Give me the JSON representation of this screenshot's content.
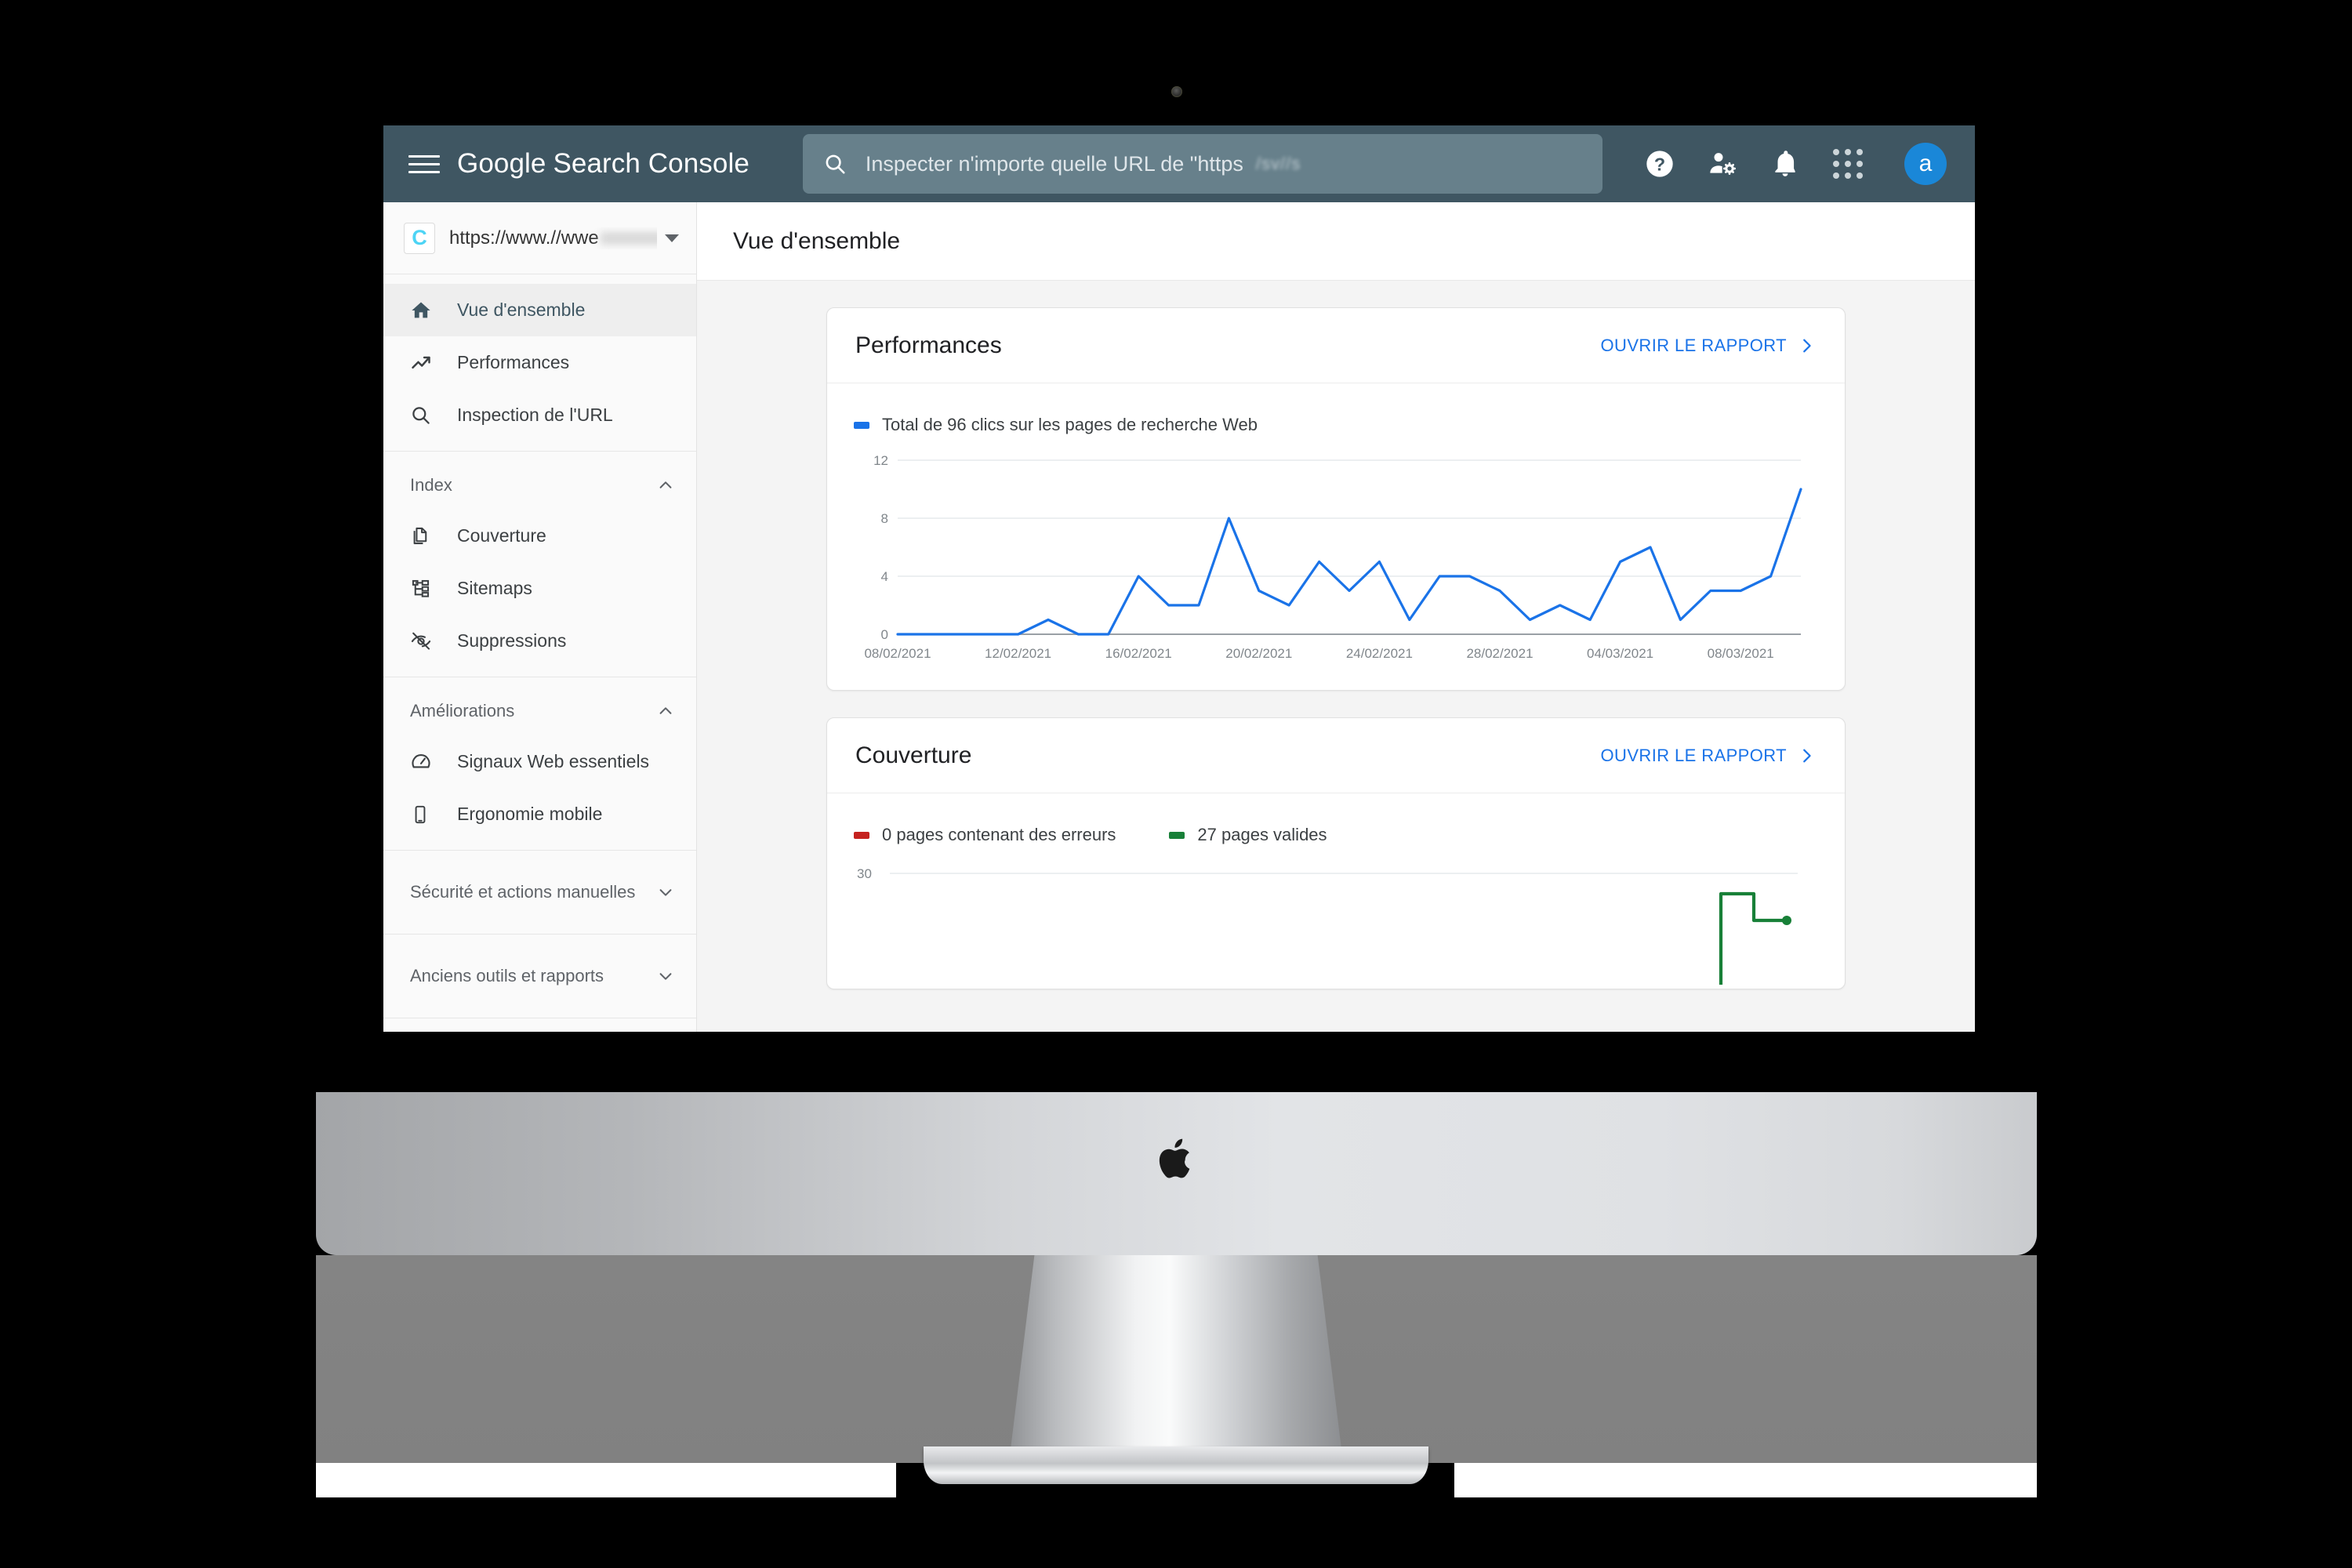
{
  "header": {
    "menu_icon": "hamburger-menu-icon",
    "brand_google": "Google",
    "brand_product": "Search Console",
    "search_icon": "search-icon",
    "search_placeholder": "Inspecter n'importe quelle URL de \"https",
    "search_value": "",
    "search_redacted": "/sv//s",
    "help_icon": "help-icon",
    "users_icon": "user-settings-icon",
    "bell_icon": "notifications-bell-icon",
    "apps_icon": "apps-grid-icon",
    "avatar_letter": "a",
    "bg_color": "#3f5662",
    "search_bg_color": "#67808b",
    "avatar_color": "#1a87d8"
  },
  "sidebar": {
    "property": {
      "favicon_letter": "C",
      "url": "https://www.//wwe"
    },
    "primary": [
      {
        "label": "Vue d'ensemble",
        "icon": "home-icon",
        "active": true
      },
      {
        "label": "Performances",
        "icon": "trending-up-icon",
        "active": false
      },
      {
        "label": "Inspection de l'URL",
        "icon": "search-icon",
        "active": false
      }
    ],
    "sections": [
      {
        "title": "Index",
        "expanded": true,
        "items": [
          {
            "label": "Couverture",
            "icon": "copy-pages-icon"
          },
          {
            "label": "Sitemaps",
            "icon": "sitemap-tree-icon"
          },
          {
            "label": "Suppressions",
            "icon": "eye-off-icon"
          }
        ]
      },
      {
        "title": "Améliorations",
        "expanded": true,
        "items": [
          {
            "label": "Signaux Web essentiels",
            "icon": "speedometer-icon"
          },
          {
            "label": "Ergonomie mobile",
            "icon": "mobile-phone-icon"
          }
        ]
      },
      {
        "title": "Sécurité et actions manuelles",
        "expanded": false,
        "items": []
      },
      {
        "title": "Anciens outils et rapports",
        "expanded": false,
        "items": []
      }
    ]
  },
  "main": {
    "page_title": "Vue d'ensemble",
    "cards": [
      {
        "title": "Performances",
        "action_label": "OUVRIR LE RAPPORT",
        "action_icon": "chevron-right-icon"
      },
      {
        "title": "Couverture",
        "action_label": "OUVRIR LE RAPPORT",
        "action_icon": "chevron-right-icon"
      }
    ]
  },
  "chart_data": [
    {
      "type": "line",
      "title": "Performances",
      "legend": [
        {
          "label": "Total de 96 clics sur les pages de recherche Web",
          "color": "#1a73e8"
        }
      ],
      "legend_position": "top-left",
      "grid": true,
      "xlabel": "",
      "ylabel": "",
      "ylim": [
        0,
        12
      ],
      "yticks": [
        0,
        4,
        8,
        12
      ],
      "xticks": [
        "08/02/2021",
        "12/02/2021",
        "16/02/2021",
        "20/02/2021",
        "24/02/2021",
        "28/02/2021",
        "04/03/2021",
        "08/03/2021"
      ],
      "x": [
        "08/02/2021",
        "09/02/2021",
        "10/02/2021",
        "11/02/2021",
        "12/02/2021",
        "13/02/2021",
        "14/02/2021",
        "15/02/2021",
        "16/02/2021",
        "17/02/2021",
        "18/02/2021",
        "19/02/2021",
        "20/02/2021",
        "21/02/2021",
        "22/02/2021",
        "23/02/2021",
        "24/02/2021",
        "25/02/2021",
        "26/02/2021",
        "27/02/2021",
        "28/02/2021",
        "01/03/2021",
        "02/03/2021",
        "03/03/2021",
        "04/03/2021",
        "05/03/2021",
        "06/03/2021",
        "07/03/2021",
        "08/03/2021",
        "09/03/2021"
      ],
      "values": [
        0,
        0,
        0,
        0,
        0,
        1,
        0,
        0,
        4,
        2,
        2,
        8,
        3,
        2,
        5,
        3,
        5,
        1,
        4,
        4,
        3,
        1,
        2,
        1,
        5,
        6,
        1,
        3,
        3,
        4,
        10
      ],
      "total_clicks": 96,
      "line_color": "#1a73e8"
    },
    {
      "type": "line",
      "title": "Couverture",
      "legend": [
        {
          "label": "0 pages contenant des erreurs",
          "color": "#c5221f"
        },
        {
          "label": "27 pages valides",
          "color": "#188038"
        }
      ],
      "legend_position": "top-left",
      "grid": true,
      "ylim": [
        0,
        30
      ],
      "yticks": [
        30
      ],
      "error_pages": 0,
      "valid_pages": 27,
      "error_color": "#c5221f",
      "valid_color": "#188038",
      "note": "clipped-by-viewport"
    }
  ]
}
